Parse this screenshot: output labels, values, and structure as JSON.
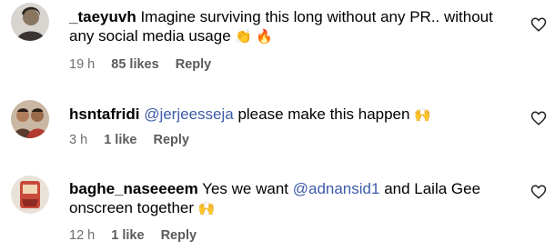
{
  "comments": [
    {
      "username": "_taeyuvh",
      "text": "Imagine surviving this long without any PR.. without any social media usage",
      "emoji": "👏 🔥",
      "time": "19 h",
      "likes": "85 likes",
      "reply": "Reply"
    },
    {
      "username": "hsntafridi",
      "mention": "@jerjeesseja",
      "text": "please make this happen",
      "emoji": "🙌",
      "time": "3 h",
      "likes": "1 like",
      "reply": "Reply"
    },
    {
      "username": "baghe_naseeeem",
      "text_before": "Yes we want",
      "mention": "@adnansid1",
      "text_after": "and Laila Gee onscreen together",
      "emoji": "🙌",
      "time": "12 h",
      "likes": "1 like",
      "reply": "Reply"
    }
  ]
}
